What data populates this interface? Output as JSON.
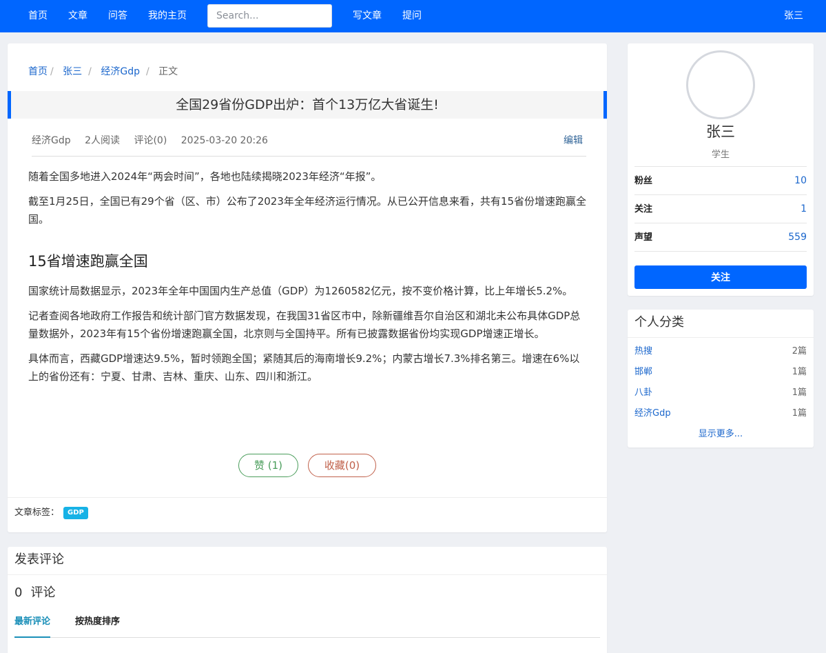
{
  "nav": {
    "home": "首页",
    "articles": "文章",
    "qa": "问答",
    "my_home": "我的主页",
    "search_placeholder": "Search...",
    "write": "写文章",
    "ask": "提问",
    "user": "张三"
  },
  "breadcrumb": {
    "home": "首页",
    "author": "张三",
    "category": "经济Gdp",
    "current": "正文"
  },
  "article": {
    "title": "全国29省份GDP出炉：首个13万亿大省诞生!",
    "meta": {
      "category": "经济Gdp",
      "reads": "2人阅读",
      "comments": "评论(0)",
      "date": "2025-03-20 20:26",
      "edit": "编辑"
    },
    "paragraphs": [
      "随着全国多地进入2024年“两会时间”，各地也陆续揭晓2023年经济“年报”。",
      "截至1月25日，全国已有29个省（区、市）公布了2023年全年经济运行情况。从已公开信息来看，共有15省份增速跑赢全国。"
    ],
    "heading": "15省增速跑赢全国",
    "paragraphs2": [
      "国家统计局数据显示，2023年全年中国国内生产总值（GDP）为1260582亿元，按不变价格计算，比上年增长5.2%。",
      "记者查阅各地政府工作报告和统计部门官方数据发现，在我国31省区市中，除新疆维吾尔自治区和湖北未公布具体GDP总量数据外，2023年有15个省份增速跑赢全国，北京则与全国持平。所有已披露数据省份均实现GDP增速正增长。",
      "具体而言，西藏GDP增速达9.5%，暂时领跑全国；紧随其后的海南增长9.2%；内蒙古增长7.3%排名第三。增速在6%以上的省份还有：宁夏、甘肃、吉林、重庆、山东、四川和浙江。"
    ],
    "like_label": "赞 (1)",
    "fav_label": "收藏(0)",
    "tags_label": "文章标签：",
    "tags": [
      "GDP"
    ]
  },
  "comments": {
    "header": "发表评论",
    "count": "0",
    "count_label": "评论",
    "tab_latest": "最新评论",
    "tab_hot": "按热度排序"
  },
  "profile": {
    "name": "张三",
    "role": "学生",
    "fans_label": "粉丝",
    "fans": "10",
    "following_label": "关注",
    "following": "1",
    "rep_label": "声望",
    "rep": "559",
    "follow_button": "关注"
  },
  "categories": {
    "header": "个人分类",
    "items": [
      {
        "name": "热搜",
        "count": "2篇"
      },
      {
        "name": "邯郸",
        "count": "1篇"
      },
      {
        "name": "八卦",
        "count": "1篇"
      },
      {
        "name": "经济Gdp",
        "count": "1篇"
      }
    ],
    "show_more": "显示更多..."
  },
  "colors": {
    "primary": "#0066ff",
    "link": "#1a66cc",
    "like": "#4a9d5b",
    "fav": "#c0604a",
    "tag": "#17b2e6",
    "page_bg": "#eef0f4"
  }
}
